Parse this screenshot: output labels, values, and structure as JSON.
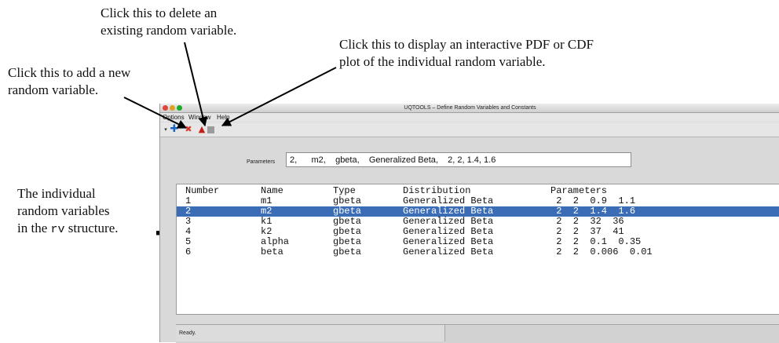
{
  "annotations": {
    "delete": [
      "Click this to delete an",
      "existing random variable."
    ],
    "plot": [
      "Click this to display an interactive PDF or CDF",
      "plot of the individual random variable."
    ],
    "add": [
      "Click this to add a new",
      "random variable."
    ],
    "rv": {
      "line1": "The individual",
      "line2": "random variables",
      "line3_pre": "in the ",
      "line3_code": "rv",
      "line3_post": " structure."
    },
    "brace_glyph": "{"
  },
  "window": {
    "title": "UQTOOLS – Define Random Variables and Constants",
    "menu": [
      "Options",
      "Window",
      "Help"
    ],
    "toolbar": {
      "dropdown_icon": "dropdown-arrow-icon",
      "add_icon": "add-plus-icon",
      "delete_icon": "delete-x-icon",
      "plot_icon": "plot-triangle-icon",
      "extra_icon": "gray-square-icon",
      "glyphs": {
        "dropdown": "▾",
        "add": "✚",
        "delete": "✖",
        "plot": "▲"
      },
      "colors": {
        "add": "#1a63c7",
        "delete": "#d83a2e",
        "plot": "#c41f17"
      }
    },
    "parameters_label": "Parameters",
    "parameters_value": "2,      m2,    gbeta,    Generalized Beta,    2, 2, 1.4, 1.6",
    "table": {
      "headers": [
        "Number",
        "Name",
        "Type",
        "Distribution",
        "Parameters"
      ],
      "rows": [
        [
          "1",
          "m1",
          "gbeta",
          "Generalized Beta",
          " 2  2  0.9  1.1"
        ],
        [
          "2",
          "m2",
          "gbeta",
          "Generalized Beta",
          " 2  2  1.4  1.6"
        ],
        [
          "3",
          "k1",
          "gbeta",
          "Generalized Beta",
          " 2  2  32  36"
        ],
        [
          "4",
          "k2",
          "gbeta",
          "Generalized Beta",
          " 2  2  37  41"
        ],
        [
          "5",
          "alpha",
          "gbeta",
          "Generalized Beta",
          " 2  2  0.1  0.35"
        ],
        [
          "6",
          "beta",
          "gbeta",
          "Generalized Beta",
          " 2  2  0.006  0.01"
        ]
      ],
      "selected_index": 1,
      "selection_color": "#3a6db5"
    },
    "status": "Ready."
  }
}
